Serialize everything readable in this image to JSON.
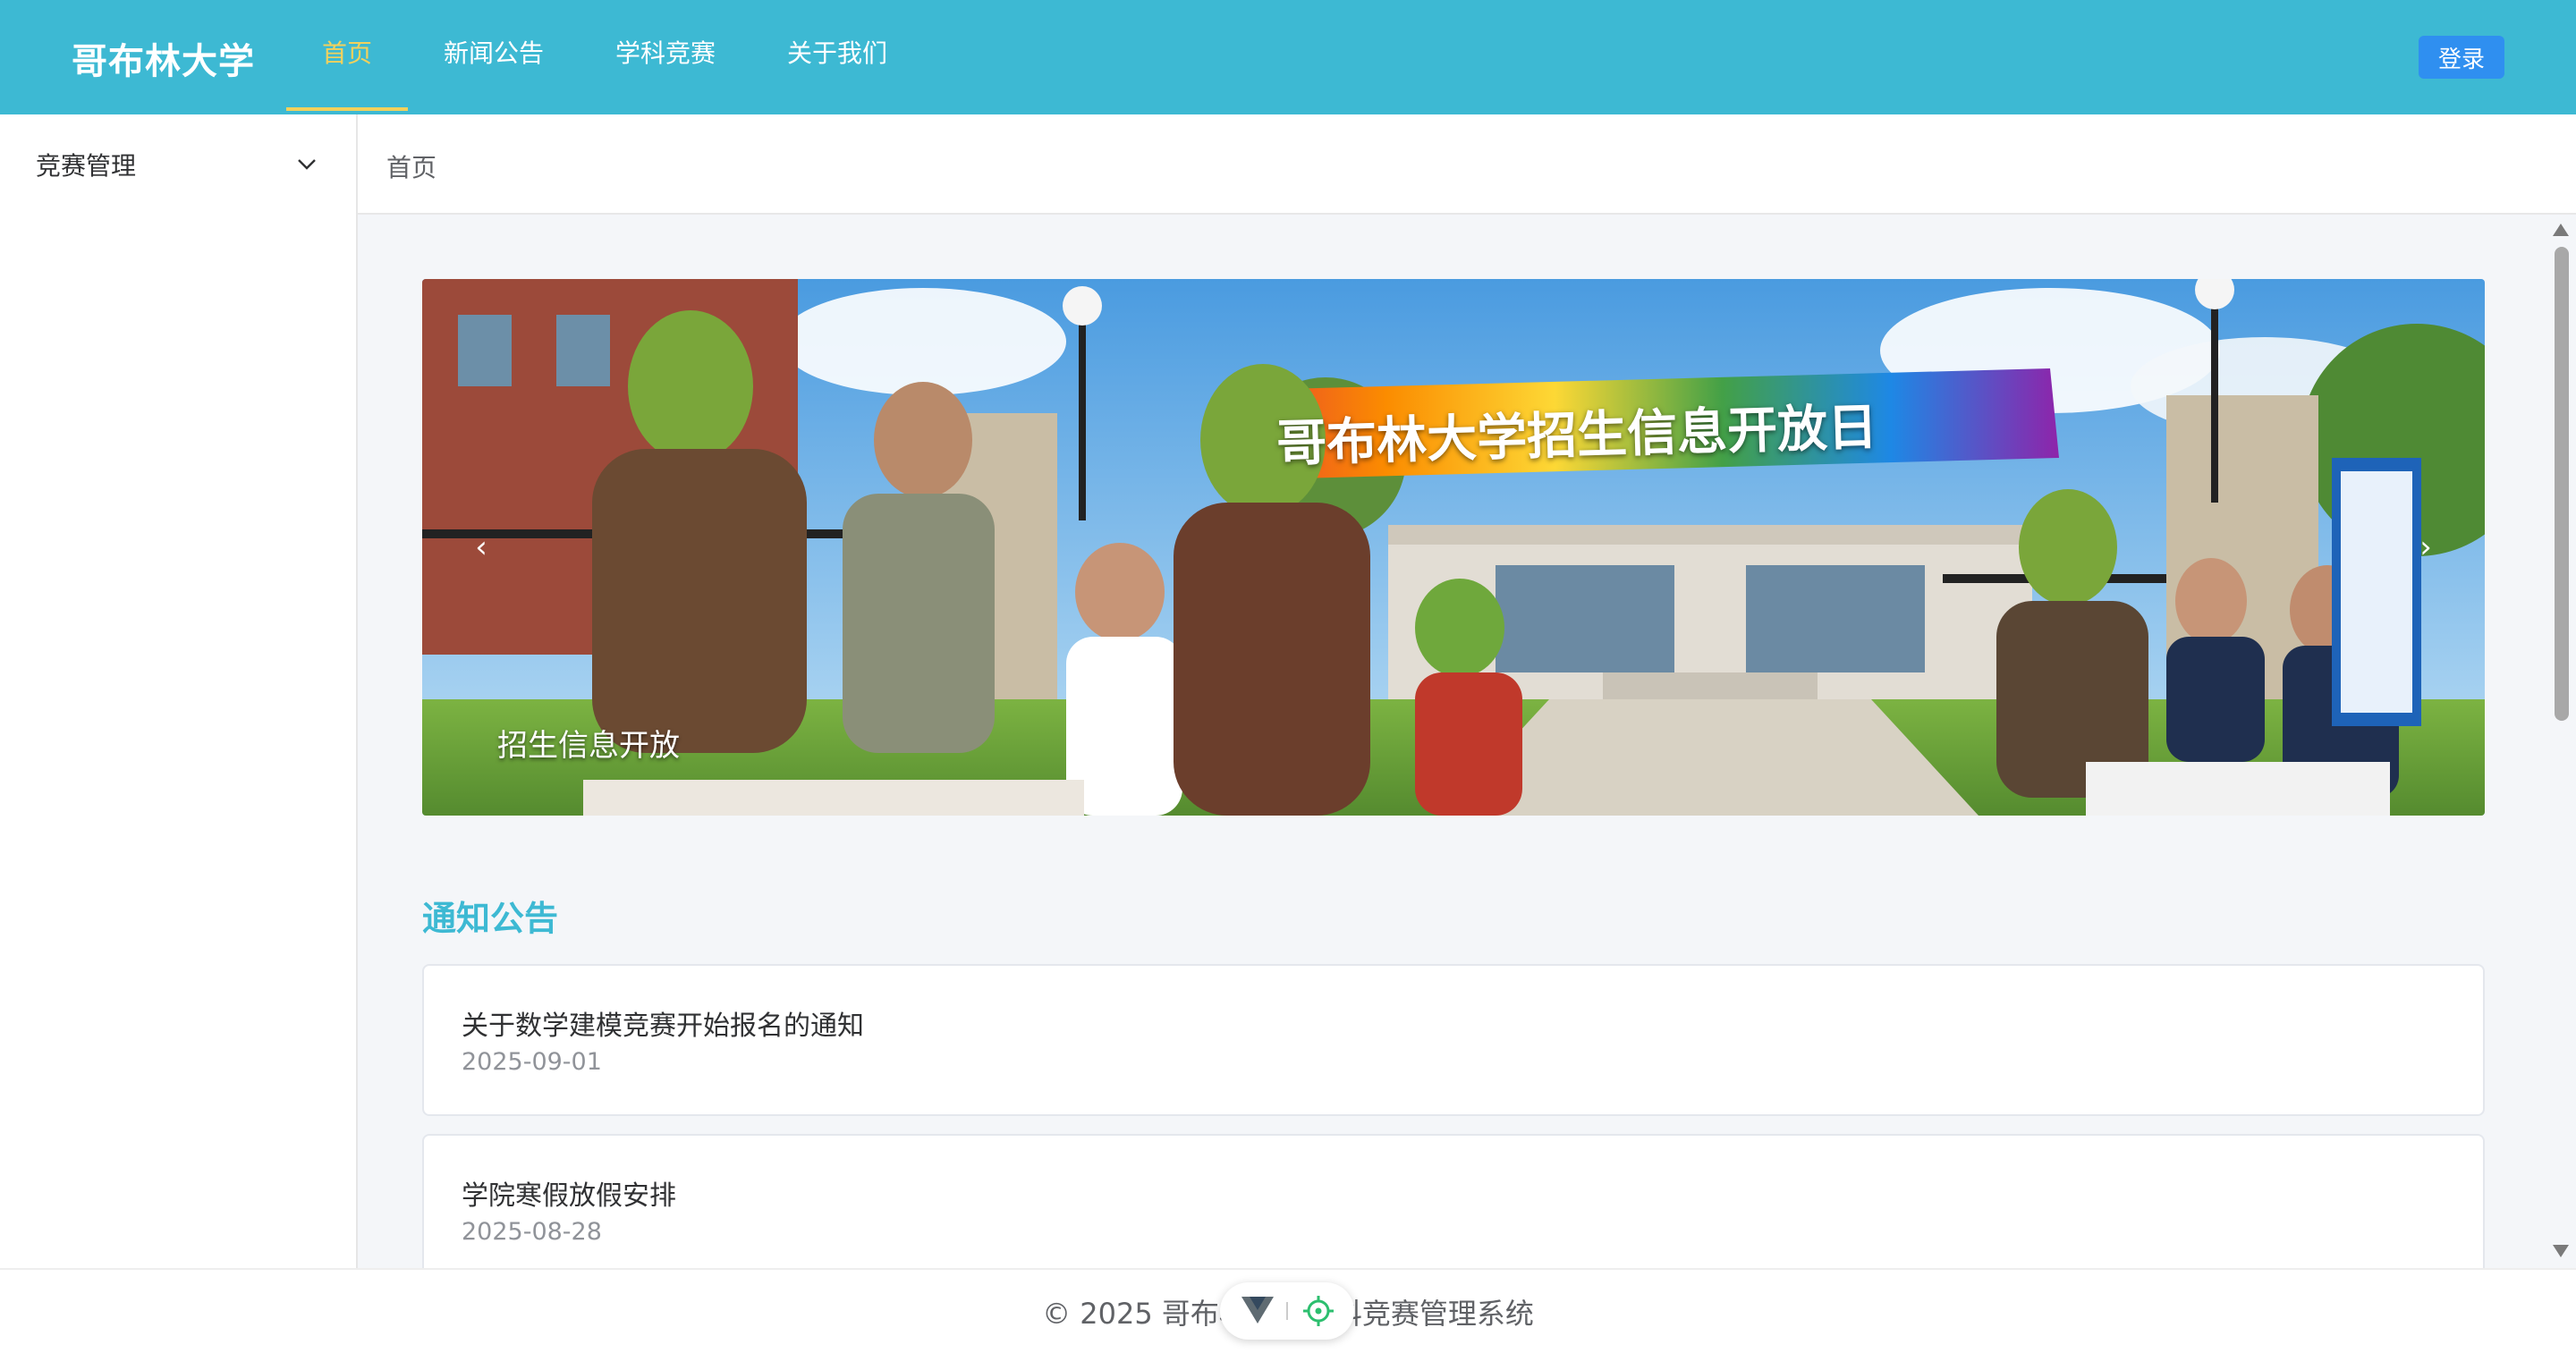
{
  "header": {
    "brand": "哥布林大学",
    "nav": [
      {
        "label": "首页",
        "active": true
      },
      {
        "label": "新闻公告",
        "active": false
      },
      {
        "label": "学科竞赛",
        "active": false
      },
      {
        "label": "关于我们",
        "active": false
      }
    ],
    "login_label": "登录"
  },
  "sidebar": {
    "menu_title": "竞赛管理",
    "icon": "chevron-down-icon"
  },
  "breadcrumb": {
    "current": "首页"
  },
  "carousel": {
    "banner_text": "哥布林大学招生信息开放日",
    "caption": "招生信息开放",
    "prev_icon": "chevron-left-icon",
    "next_icon": "chevron-right-icon",
    "slide_count": 2,
    "active_slide": 1
  },
  "notices": {
    "title": "通知公告",
    "items": [
      {
        "title": "关于数学建模竞赛开始报名的通知",
        "date": "2025-09-01"
      },
      {
        "title": "学院寒假放假安排",
        "date": "2025-08-28"
      }
    ]
  },
  "footer": {
    "text": "© 2025 哥布林大学学科竞赛管理系统"
  },
  "colors": {
    "header_bg": "#3db9d3",
    "active_nav": "#f2d15c",
    "login_bg": "#2f8ff0",
    "section_title": "#3db9d3",
    "content_bg": "#f4f6f9"
  }
}
